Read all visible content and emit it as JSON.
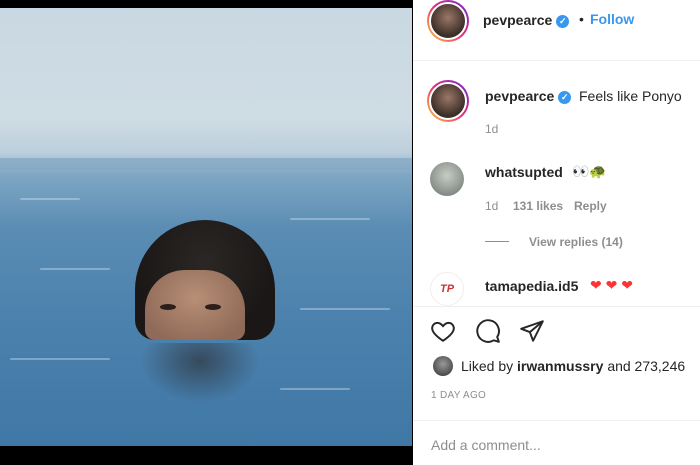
{
  "header": {
    "username": "pevpearce",
    "separator": "•",
    "follow_label": "Follow"
  },
  "caption": {
    "username": "pevpearce",
    "text": "Feels like Ponyo",
    "time": "1d"
  },
  "comments": [
    {
      "username": "whatsupted",
      "text": "👀🐢",
      "time": "1d",
      "likes": "131 likes",
      "reply_label": "Reply",
      "view_replies": "View replies (14)"
    },
    {
      "username": "tamapedia.id5",
      "text": "❤ ❤ ❤"
    }
  ],
  "actions": {
    "like_icon": "heart-outline-icon",
    "comment_icon": "comment-bubble-icon",
    "share_icon": "paper-plane-icon"
  },
  "likes": {
    "prefix": "Liked by",
    "user": "irwanmussry",
    "suffix": "and 273,246"
  },
  "timestamp": "1 DAY AGO",
  "comment_input": {
    "placeholder": "Add a comment..."
  },
  "colors": {
    "accent": "#3897f0",
    "heart": "#ff3333",
    "muted": "#8e8e8e"
  }
}
